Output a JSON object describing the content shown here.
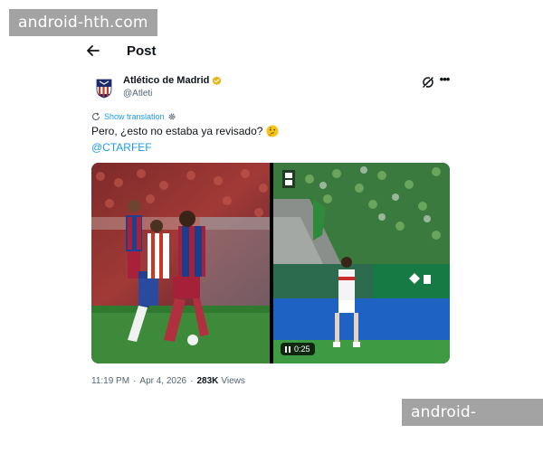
{
  "watermarks": {
    "top": "android-hth.com",
    "bottom": "android-hth.com"
  },
  "header": {
    "title": "Post"
  },
  "post": {
    "author_name": "Atlético de Madrid",
    "handle": "@Atleti",
    "translate_label": "Show translation",
    "text": "Pero, ¿esto no estaba ya revisado?",
    "mention": "@CTARFEF",
    "video_time": "0:25",
    "time": "11:19 PM",
    "separator": "·",
    "date": "Apr 4, 2026",
    "views_count": "283K",
    "views_label": "Views"
  },
  "icons": {
    "back": "arrow-left-icon",
    "verified": "verified-badge-icon",
    "grok": "grok-icon",
    "more": "more-icon",
    "translate": "translate-icon",
    "settings": "gear-icon",
    "emoji": "thinking-face-emoji",
    "pause": "pause-icon"
  },
  "colors": {
    "link": "#1d9bf0",
    "secondary_text": "#536471",
    "primary_text": "#0f1419",
    "verified_gold": "#e2b719"
  }
}
